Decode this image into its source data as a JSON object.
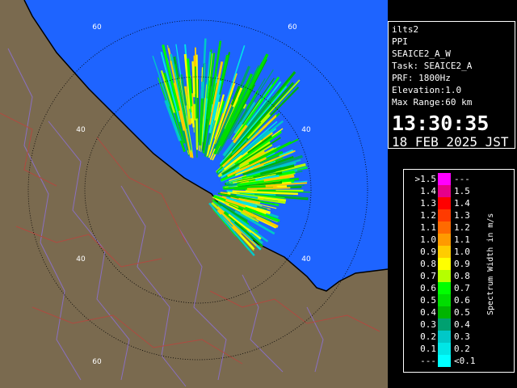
{
  "info": {
    "lines": [
      "ilts2",
      "PPI",
      "SEAICE2_A_W",
      "Task: SEAICE2_A",
      "PRF: 1800Hz",
      "Elevation:1.0",
      "Max Range:60 km"
    ],
    "time": "13:30:35",
    "date": "18 FEB 2025 JST"
  },
  "radar": {
    "range_labels": [
      "60",
      "60",
      "40",
      "40",
      "40",
      "40",
      "60"
    ],
    "colors": {
      "sea": "#1e64ff",
      "land": "#7a6a4f",
      "ring": "#000000"
    }
  },
  "legend": {
    "rows": [
      {
        "lo": ">1.5",
        "hi": "---",
        "color": "#ff00ff"
      },
      {
        "lo": "1.4",
        "hi": "1.5",
        "color": "#e6008a"
      },
      {
        "lo": "1.3",
        "hi": "1.4",
        "color": "#ff0000"
      },
      {
        "lo": "1.2",
        "hi": "1.3",
        "color": "#ff3a00"
      },
      {
        "lo": "1.1",
        "hi": "1.2",
        "color": "#ff6a00"
      },
      {
        "lo": "1.0",
        "hi": "1.1",
        "color": "#ff9a00"
      },
      {
        "lo": "0.9",
        "hi": "1.0",
        "color": "#ffcc00"
      },
      {
        "lo": "0.8",
        "hi": "0.9",
        "color": "#ffff00"
      },
      {
        "lo": "0.7",
        "hi": "0.8",
        "color": "#b5ff00"
      },
      {
        "lo": "0.6",
        "hi": "0.7",
        "color": "#00ff00"
      },
      {
        "lo": "0.5",
        "hi": "0.6",
        "color": "#00dd00"
      },
      {
        "lo": "0.4",
        "hi": "0.5",
        "color": "#00b400"
      },
      {
        "lo": "0.3",
        "hi": "0.4",
        "color": "#00a070"
      },
      {
        "lo": "0.2",
        "hi": "0.3",
        "color": "#00c8c8"
      },
      {
        "lo": "0.1",
        "hi": "0.2",
        "color": "#00e6e6"
      },
      {
        "lo": "---",
        "hi": "<0.1",
        "color": "#00ffff"
      }
    ],
    "unit": "Spectrum Width in m/s"
  }
}
